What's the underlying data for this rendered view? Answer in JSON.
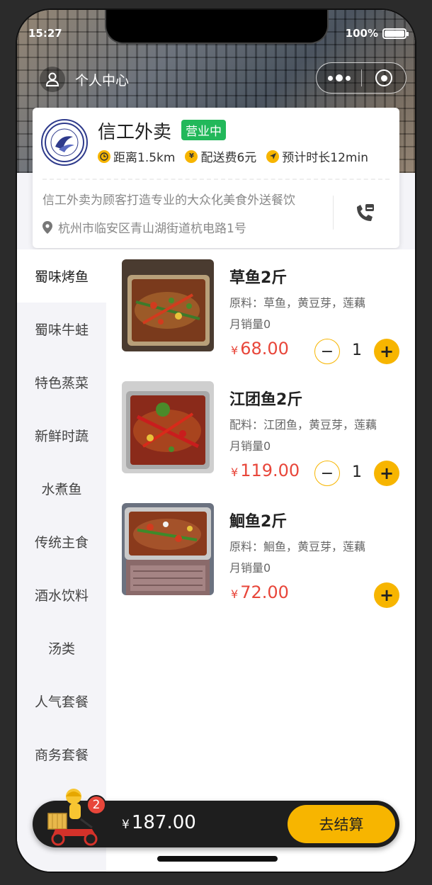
{
  "status": {
    "time": "15:27",
    "battery": "100%"
  },
  "header": {
    "personal_label": "个人中心"
  },
  "store": {
    "name": "信工外卖",
    "status_badge": "营业中",
    "distance": "距离1.5km",
    "delivery_fee": "配送费6元",
    "eta": "预计时长12min",
    "description": "信工外卖为顾客打造专业的大众化美食外送餐饮",
    "address": "杭州市临安区青山湖街道杭电路1号",
    "accent_color": "#f7b500",
    "open_color": "#22b85a"
  },
  "categories": [
    {
      "label": "蜀味烤鱼",
      "active": true
    },
    {
      "label": "蜀味牛蛙",
      "active": false
    },
    {
      "label": "特色蒸菜",
      "active": false
    },
    {
      "label": "新鲜时蔬",
      "active": false
    },
    {
      "label": "水煮鱼",
      "active": false
    },
    {
      "label": "传统主食",
      "active": false
    },
    {
      "label": "酒水饮料",
      "active": false
    },
    {
      "label": "汤类",
      "active": false
    },
    {
      "label": "人气套餐",
      "active": false
    },
    {
      "label": "商务套餐",
      "active": false
    }
  ],
  "dishes": [
    {
      "name": "草鱼2斤",
      "ingredients": "原料：草鱼，黄豆芽，莲藕",
      "sales": "月销量0",
      "currency": "¥",
      "price": "68.00",
      "qty": "1",
      "minus": "−",
      "plus": "+"
    },
    {
      "name": "江团鱼2斤",
      "ingredients": "配料：江团鱼，黄豆芽，莲藕",
      "sales": "月销量0",
      "currency": "¥",
      "price": "119.00",
      "qty": "1",
      "minus": "−",
      "plus": "+"
    },
    {
      "name": "鮰鱼2斤",
      "ingredients": "原料：鮰鱼，黄豆芽，莲藕",
      "sales": "月销量0",
      "currency": "¥",
      "price": "72.00",
      "plus": "+"
    }
  ],
  "cart": {
    "count": "2",
    "currency": "¥",
    "total": "187.00",
    "checkout_label": "去结算"
  },
  "icons": [
    "user-icon",
    "more-dots-icon",
    "target-icon",
    "school-logo",
    "clock-icon",
    "yen-icon",
    "navigate-icon",
    "location-pin-icon",
    "phone-icon",
    "delivery-rider-icon"
  ]
}
